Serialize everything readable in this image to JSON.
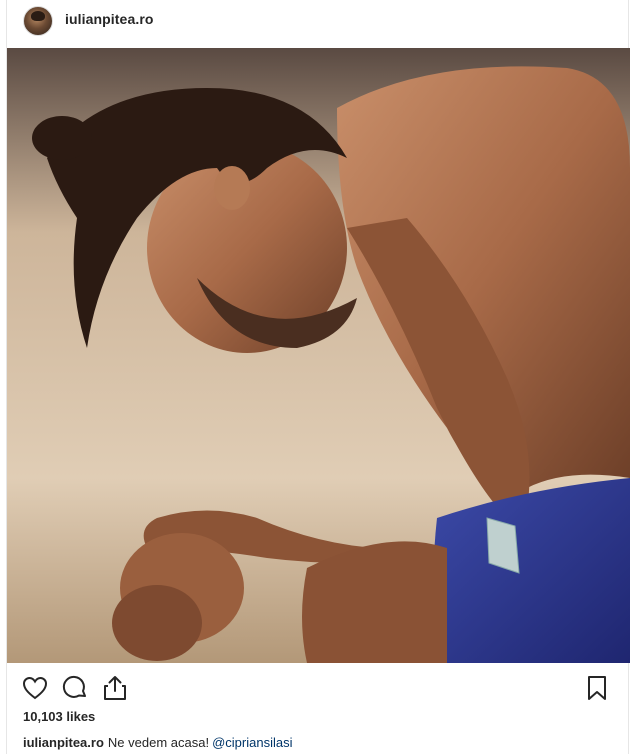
{
  "post": {
    "username": "iulianpitea.ro",
    "likes": "10,103 likes",
    "caption_user": "iulianpitea.ro",
    "caption_text": "Ne vedem acasa!",
    "caption_mention": "@cipriansilasi"
  },
  "icons": {
    "avatar": "profile-avatar",
    "like": "heart-icon",
    "comment": "comment-icon",
    "share": "share-icon",
    "save": "bookmark-icon"
  },
  "colors": {
    "text": "#262626",
    "mention": "#003569",
    "border": "#e6e6e6"
  }
}
